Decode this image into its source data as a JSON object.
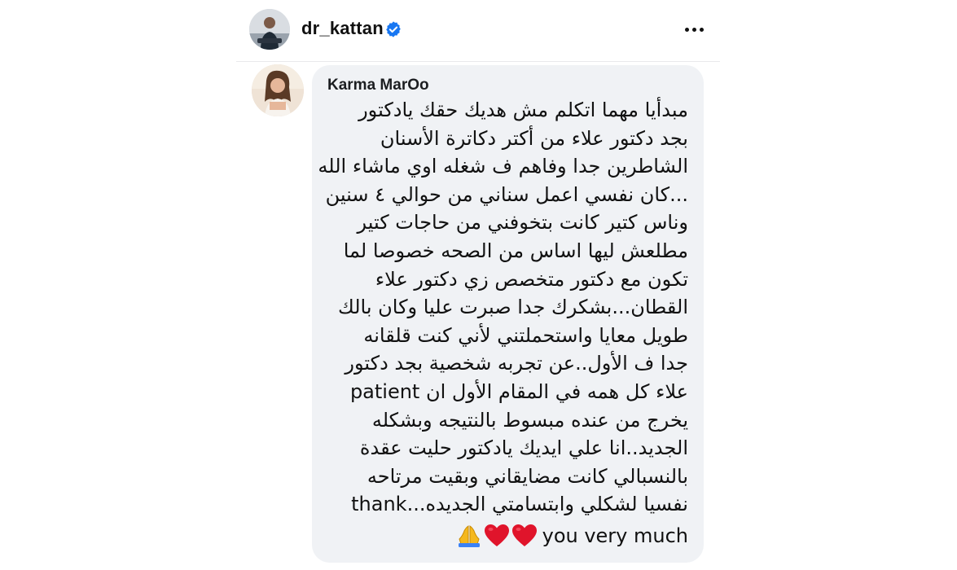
{
  "header": {
    "username": "dr_kattan",
    "verified_icon": "verified-badge-icon",
    "more_icon": "more-horizontal-icon",
    "colors": {
      "verified": "#1877f2",
      "divider": "#e9e9ec"
    }
  },
  "comment": {
    "author": "Karma MarOo",
    "lines": [
      "مبدأيا مهما اتكلم مش هديك حقك يادكتور",
      "بجد دكتور علاء من أكتر دكاترة الأسنان",
      "الشاطرين جدا وفاهم ف شغله اوي  ماشاء الله",
      "...كان نفسي اعمل سناني من حوالي ٤ سنين",
      "وناس كتير كانت بتخوفني من حاجات كتير",
      "مطلعش ليها اساس من الصحه خصوصا لما",
      "تكون مع دكتور متخصص زي دكتور علاء",
      "القطان...بشكرك جدا صبرت عليا وكان بالك",
      "طويل معايا  واستحملتني لأني كنت قلقانه",
      "جدا ف الأول..عن تجربه شخصية بجد دكتور",
      "علاء كل همه في المقام الأول ان patient",
      "يخرج من عنده مبسوط بالنتيجه وبشكله",
      "الجديد..انا علي ايديك يادكتور حليت عقدة",
      "بالنسبالي كانت مضايقاني وبقيت مرتاحه",
      "نفسيا لشكلي وابتسامتي الجديده...thank"
    ],
    "last_line": "you very much",
    "emojis": [
      "folded-hands-icon",
      "red-heart-icon",
      "red-heart-icon"
    ],
    "colors": {
      "bubble": "#f0f2f5",
      "heart": "#e0142b",
      "hands": "#f5b81d"
    }
  }
}
